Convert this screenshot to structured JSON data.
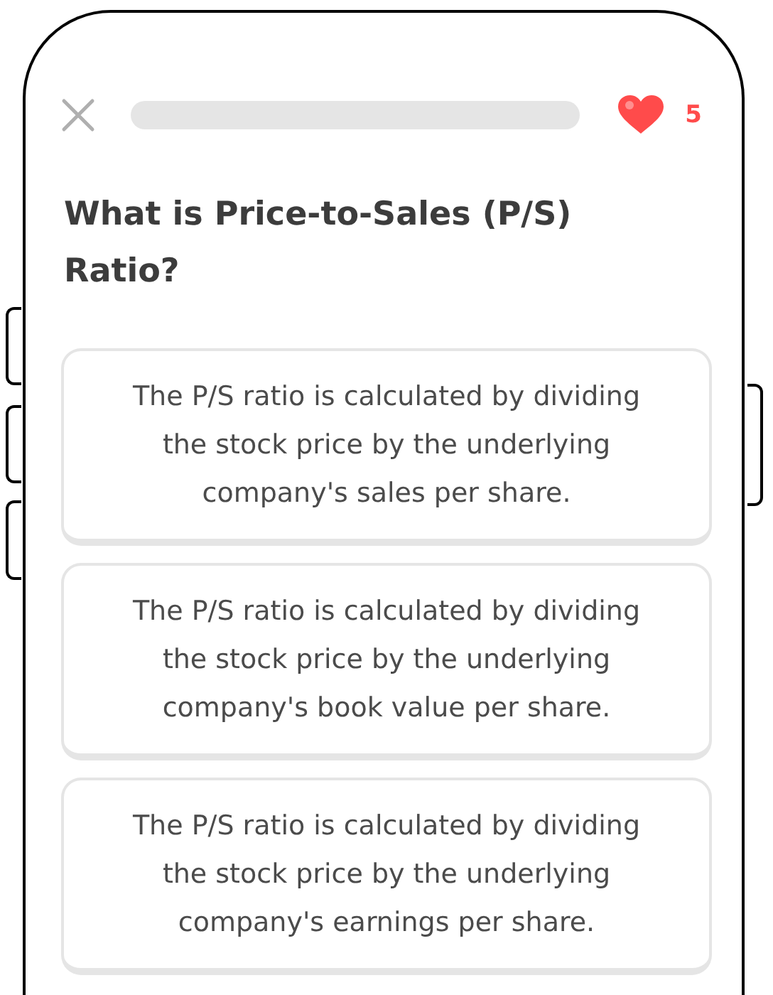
{
  "lives": "5",
  "question": "What is Price-to-Sales (P/S) Ratio?",
  "options": [
    {
      "text": "The P/S ratio is calculated by dividing the stock price by the underlying company's sales per share.",
      "selected": false
    },
    {
      "text": "The P/S ratio is calculated by dividing the stock price by the underlying company's book value per share.",
      "selected": false
    },
    {
      "text": "The P/S ratio is calculated by dividing the stock price by the underlying company's earnings per share.",
      "selected": false
    }
  ]
}
